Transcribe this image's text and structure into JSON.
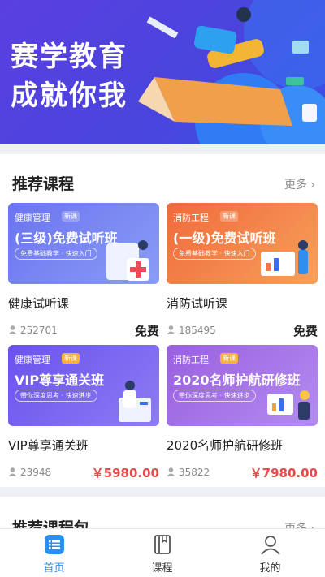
{
  "banner": {
    "line1": "赛学教育",
    "line2": "成就你我"
  },
  "recommend": {
    "title": "推荐课程",
    "more": "更多 ›",
    "courses": [
      {
        "category": "健康管理",
        "tag": "新课",
        "banner_title": "(三级)免费试听班",
        "banner_sub": "免费基础教学 · 快速入门",
        "name": "健康试听课",
        "students": "252701",
        "price": "免费",
        "theme": "#6f7df0"
      },
      {
        "category": "消防工程",
        "tag": "新课",
        "banner_title": "(一级)免费试听班",
        "banner_sub": "免费基础教学 · 快速入门",
        "name": "消防试听课",
        "students": "185495",
        "price": "免费",
        "theme": "#f07a45"
      },
      {
        "category": "健康管理",
        "tag": "新课",
        "banner_title": "VIP尊享通关班",
        "banner_sub": "带你深度思考 · 快速进步",
        "name": "VIP尊享通关班",
        "students": "23948",
        "price": "￥5980.00",
        "theme": "#7a5cf0"
      },
      {
        "category": "消防工程",
        "tag": "新课",
        "banner_title": "2020名师护航研修班",
        "banner_sub": "带你深度思考 · 快速进步",
        "name": "2020名师护航研修班",
        "students": "35822",
        "price": "￥7980.00",
        "theme": "#9b6ad8"
      }
    ]
  },
  "package_section": {
    "title": "推荐课程包",
    "more": "更多 ›"
  },
  "tabbar": {
    "tabs": [
      {
        "label": "首页",
        "active": true
      },
      {
        "label": "课程",
        "active": false
      },
      {
        "label": "我的",
        "active": false
      }
    ]
  }
}
